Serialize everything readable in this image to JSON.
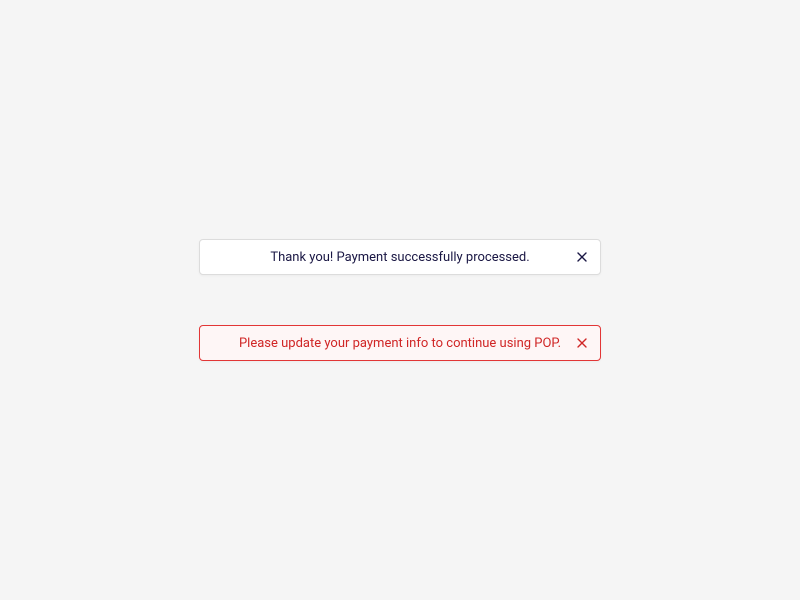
{
  "toasts": {
    "success": {
      "message": "Thank you! Payment successfully processed."
    },
    "warning": {
      "message": "Please update your payment info to continue using POP."
    }
  }
}
